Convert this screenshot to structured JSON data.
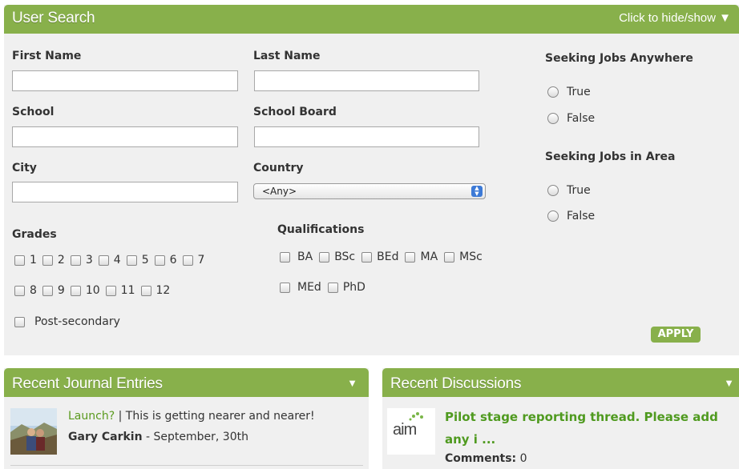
{
  "user_search": {
    "title": "User Search",
    "toggle_label": "Click to hide/show",
    "first_name": {
      "label": "First Name",
      "value": ""
    },
    "last_name": {
      "label": "Last Name",
      "value": ""
    },
    "school": {
      "label": "School",
      "value": ""
    },
    "school_board": {
      "label": "School Board",
      "value": ""
    },
    "city": {
      "label": "City",
      "value": ""
    },
    "country": {
      "label": "Country",
      "selected": "<Any>"
    },
    "seeking_anywhere": {
      "label": "Seeking Jobs Anywhere",
      "options": [
        "True",
        "False"
      ]
    },
    "seeking_area": {
      "label": "Seeking Jobs in Area",
      "options": [
        "True",
        "False"
      ]
    },
    "grades": {
      "label": "Grades",
      "row1": [
        "1",
        "2",
        "3",
        "4",
        "5",
        "6",
        "7"
      ],
      "row2": [
        "8",
        "9",
        "10",
        "11",
        "12"
      ],
      "post_secondary": "Post-secondary"
    },
    "qualifications": {
      "label": "Qualifications",
      "row1": [
        "BA",
        "BSc",
        "BEd",
        "MA",
        "MSc"
      ],
      "row2": [
        "MEd",
        "PhD"
      ]
    },
    "apply_label": "APPLY"
  },
  "journal": {
    "title": "Recent Journal Entries",
    "entry": {
      "link": "Launch?",
      "separator": " | ",
      "text": "This is getting nearer and nearer!",
      "author": "Gary Carkin",
      "date_sep": " - ",
      "date": "September, 30th"
    }
  },
  "discussions": {
    "title": "Recent Discussions",
    "logo_text": "aim",
    "item": {
      "title": "Pilot stage reporting thread. Please add any i ...",
      "comments_label": "Comments:",
      "comments_count": "0"
    }
  },
  "colors": {
    "accent": "#88b04b",
    "panel": "#f0f0f0",
    "link": "#5a9a1e"
  }
}
